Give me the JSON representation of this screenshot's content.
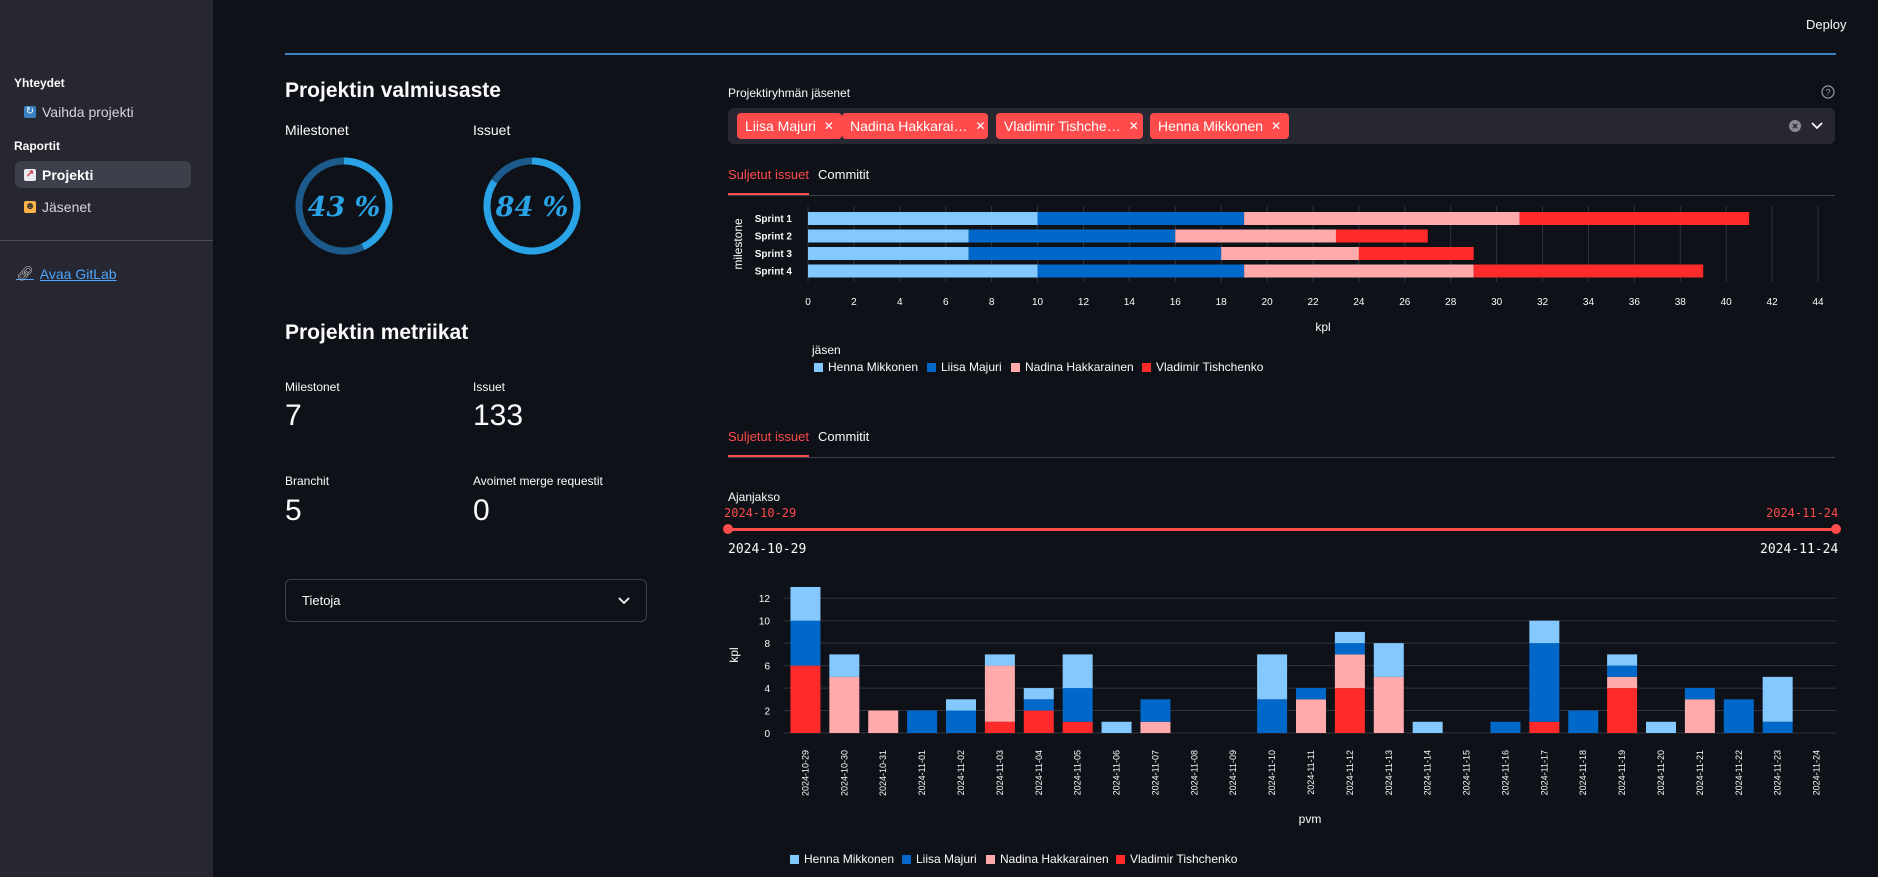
{
  "header": {
    "deploy_label": "Deploy"
  },
  "sidebar": {
    "section_connections": "Yhteydet",
    "change_project": "Vaihda projekti",
    "section_reports": "Raportit",
    "project": "Projekti",
    "members": "Jäsenet",
    "gitlab_link": "Avaa GitLab"
  },
  "progress": {
    "title": "Projektin valmiusaste",
    "milestones_label": "Milestonet",
    "milestones_value": "43 %",
    "milestones_fraction": 0.43,
    "issues_label": "Issuet",
    "issues_value": "84 %",
    "issues_fraction": 0.84
  },
  "metrics": {
    "title": "Projektin metriikat",
    "items": [
      {
        "label": "Milestonet",
        "value": "7"
      },
      {
        "label": "Issuet",
        "value": "133"
      },
      {
        "label": "Branchit",
        "value": "5"
      },
      {
        "label": "Avoimet merge requestit",
        "value": "0"
      }
    ]
  },
  "expander": {
    "label": "Tietoja"
  },
  "members_select": {
    "label": "Projektiryhmän jäsenet",
    "chips": [
      "Liisa Majuri",
      "Nadina Hakkarai…",
      "Vladimir Tishche…",
      "Henna Mikkonen"
    ]
  },
  "tabs1": [
    "Suljetut issuet",
    "Commitit"
  ],
  "tabs2": [
    "Suljetut issuet",
    "Commitit"
  ],
  "slider": {
    "label": "Ajanjakso",
    "start": "2024-10-29",
    "end": "2024-11-24",
    "min": "2024-10-29",
    "max": "2024-11-24"
  },
  "colors": {
    "henna": "#83c9ff",
    "liisa": "#0068c9",
    "nadina": "#ffabab",
    "vladimir": "#ff2b2b",
    "accent": "#ff4b4b"
  },
  "chart_data": [
    {
      "type": "bar",
      "orientation": "horizontal",
      "stacked": true,
      "categories": [
        "Sprint 1",
        "Sprint 2",
        "Sprint 3",
        "Sprint 4"
      ],
      "series": [
        {
          "name": "Henna Mikkonen",
          "values": [
            10,
            7,
            7,
            10
          ]
        },
        {
          "name": "Liisa Majuri",
          "values": [
            9,
            9,
            11,
            9
          ]
        },
        {
          "name": "Nadina Hakkarainen",
          "values": [
            12,
            7,
            6,
            10
          ]
        },
        {
          "name": "Vladimir Tishchenko",
          "values": [
            10,
            4,
            5,
            10
          ]
        }
      ],
      "xlabel": "kpl",
      "ylabel": "milestone",
      "xlim": [
        0,
        44
      ],
      "xticks": [
        "0",
        "2",
        "4",
        "6",
        "8",
        "10",
        "12",
        "14",
        "16",
        "18",
        "20",
        "22",
        "24",
        "26",
        "28",
        "30",
        "32",
        "34",
        "36",
        "38",
        "40",
        "42",
        "44"
      ],
      "legend_title": "jäsen",
      "legend_position": "bottom-left"
    },
    {
      "type": "bar",
      "stacked": true,
      "categories": [
        "2024-10-29",
        "2024-10-30",
        "2024-10-31",
        "2024-11-01",
        "2024-11-02",
        "2024-11-03",
        "2024-11-04",
        "2024-11-05",
        "2024-11-06",
        "2024-11-07",
        "2024-11-08",
        "2024-11-09",
        "2024-11-10",
        "2024-11-11",
        "2024-11-12",
        "2024-11-13",
        "2024-11-14",
        "2024-11-15",
        "2024-11-16",
        "2024-11-17",
        "2024-11-18",
        "2024-11-19",
        "2024-11-20",
        "2024-11-21",
        "2024-11-22",
        "2024-11-23",
        "2024-11-24"
      ],
      "series": [
        {
          "name": "Vladimir Tishchenko",
          "values": [
            6,
            0,
            0,
            0,
            0,
            1,
            2,
            1,
            0,
            0,
            0,
            0,
            0,
            0,
            4,
            0,
            0,
            0,
            0,
            1,
            0,
            4,
            0,
            0,
            0,
            0,
            0
          ]
        },
        {
          "name": "Nadina Hakkarainen",
          "values": [
            0,
            5,
            2,
            0,
            0,
            5,
            0,
            0,
            0,
            1,
            0,
            0,
            0,
            3,
            3,
            5,
            0,
            0,
            0,
            0,
            0,
            1,
            0,
            3,
            0,
            0,
            0
          ]
        },
        {
          "name": "Liisa Majuri",
          "values": [
            4,
            0,
            0,
            2,
            2,
            0,
            1,
            3,
            0,
            2,
            0,
            0,
            3,
            1,
            1,
            0,
            0,
            0,
            1,
            7,
            2,
            1,
            0,
            1,
            3,
            1,
            0
          ]
        },
        {
          "name": "Henna Mikkonen",
          "values": [
            3,
            2,
            0,
            0,
            1,
            1,
            1,
            3,
            1,
            0,
            0,
            0,
            4,
            0,
            1,
            3,
            1,
            0,
            0,
            2,
            0,
            1,
            1,
            0,
            0,
            4,
            0
          ]
        }
      ],
      "xlabel": "pvm",
      "ylabel": "kpl",
      "ylim": [
        0,
        13
      ],
      "yticks": [
        "0",
        "2",
        "4",
        "6",
        "8",
        "10",
        "12"
      ],
      "legend_position": "bottom"
    }
  ]
}
